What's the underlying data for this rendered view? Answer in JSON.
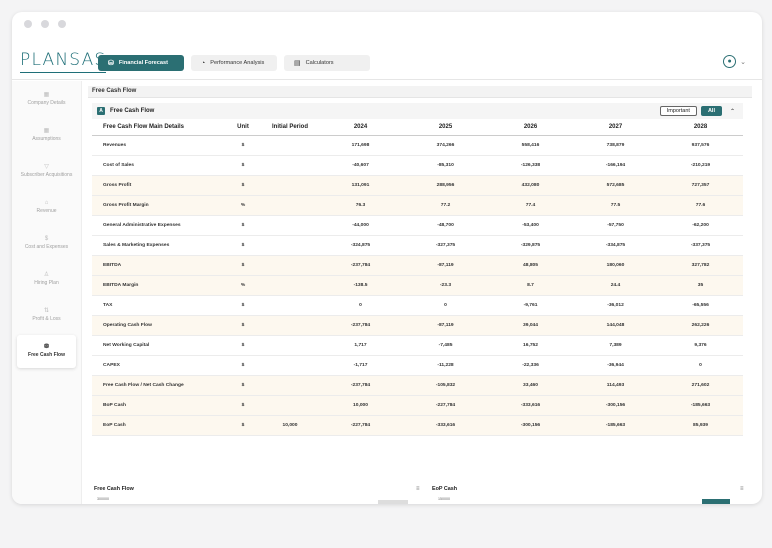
{
  "app": {
    "logo": "PLANSAS"
  },
  "tabs": [
    {
      "label": "Financial Forecast",
      "icon": "financial-forecast-icon"
    },
    {
      "label": "Performance Analysis",
      "icon": "performance-analysis-icon"
    },
    {
      "label": "Calculators",
      "icon": "calculator-icon"
    }
  ],
  "sidebar": {
    "items": [
      {
        "label": "Company Details",
        "icon": "company-details-icon"
      },
      {
        "label": "Assumptions",
        "icon": "assumptions-icon"
      },
      {
        "label": "Subscriber Acquisitions",
        "icon": "subscriber-acquisitions-icon"
      },
      {
        "label": "Revenue",
        "icon": "revenue-icon"
      },
      {
        "label": "Cost and Expenses",
        "icon": "cost-and-expenses-icon"
      },
      {
        "label": "Hiring Plan",
        "icon": "hiring-plan-icon"
      },
      {
        "label": "Profit & Loss",
        "icon": "profit-and-loss-icon"
      },
      {
        "label": "Free Cash Flow",
        "icon": "free-cash-flow-icon"
      }
    ]
  },
  "breadcrumb": "Free Cash Flow",
  "panel": {
    "badge": "A",
    "title": "Free Cash Flow",
    "important_label": "Important",
    "all_label": "All"
  },
  "table": {
    "columns": [
      "Free Cash Flow Main Details",
      "Unit",
      "Initial Period",
      "2024",
      "2025",
      "2026",
      "2027",
      "2028"
    ],
    "rows": [
      {
        "cells": [
          "Revenues",
          "$",
          "",
          "171,698",
          "374,266",
          "558,416",
          "738,879",
          "937,576"
        ],
        "hl": false
      },
      {
        "cells": [
          "Cost of Sales",
          "$",
          "",
          "-40,607",
          "-85,310",
          "-126,338",
          "-166,194",
          "-210,219"
        ],
        "hl": false
      },
      {
        "cells": [
          "Gross Profit",
          "$",
          "",
          "131,091",
          "288,956",
          "432,080",
          "572,685",
          "727,357"
        ],
        "hl": true
      },
      {
        "cells": [
          "Gross Profit Margin",
          "%",
          "",
          "76.3",
          "77.2",
          "77.4",
          "77.5",
          "77.6"
        ],
        "hl": true
      },
      {
        "cells": [
          "General Administrative Expenses",
          "$",
          "",
          "-44,000",
          "-48,700",
          "-53,400",
          "-57,750",
          "-62,200"
        ],
        "hl": false
      },
      {
        "cells": [
          "Sales & Marketing Expenses",
          "$",
          "",
          "-324,875",
          "-327,375",
          "-329,875",
          "-334,875",
          "-337,375"
        ],
        "hl": false
      },
      {
        "cells": [
          "EBITDA",
          "$",
          "",
          "-237,784",
          "-87,119",
          "48,805",
          "180,060",
          "327,782"
        ],
        "hl": true
      },
      {
        "cells": [
          "EBITDA Margin",
          "%",
          "",
          "-138.5",
          "-23.3",
          "8.7",
          "24.4",
          "35"
        ],
        "hl": true
      },
      {
        "cells": [
          "TAX",
          "$",
          "",
          "0",
          "0",
          "-9,761",
          "-36,012",
          "-65,556"
        ],
        "hl": false
      },
      {
        "cells": [
          "Operating Cash Flow",
          "$",
          "",
          "-237,784",
          "-87,119",
          "39,044",
          "144,048",
          "262,226"
        ],
        "hl": true
      },
      {
        "cells": [
          "Net Working Capital",
          "$",
          "",
          "1,717",
          "-7,485",
          "16,752",
          "7,389",
          "9,376"
        ],
        "hl": false
      },
      {
        "cells": [
          "CAPEX",
          "$",
          "",
          "-1,717",
          "-11,228",
          "-22,336",
          "-36,944",
          "0"
        ],
        "hl": false
      },
      {
        "cells": [
          "Free Cash Flow / Net Cash Change",
          "$",
          "",
          "-237,784",
          "-105,832",
          "33,460",
          "114,493",
          "271,602"
        ],
        "hl": true
      },
      {
        "cells": [
          "BoP Cash",
          "$",
          "",
          "10,000",
          "-227,784",
          "-333,616",
          "-300,156",
          "-185,663"
        ],
        "hl": true
      },
      {
        "cells": [
          "EoP Cash",
          "$",
          "10,000",
          "-227,784",
          "-333,616",
          "-300,156",
          "-185,663",
          "85,939"
        ],
        "hl": true
      }
    ]
  },
  "charts": [
    {
      "title": "Free Cash Flow",
      "top_tick": "300000"
    },
    {
      "title": "EoP Cash",
      "top_tick": "150000"
    }
  ],
  "colors": {
    "accent": "#2b6f73",
    "highlight_row": "#fdf8ef"
  }
}
